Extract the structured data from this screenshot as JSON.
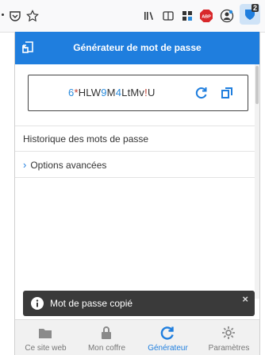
{
  "browser": {
    "badge_count": "2",
    "abp_label": "ABP"
  },
  "popup": {
    "title": "Générateur de mot de passe",
    "password": {
      "segments": [
        {
          "text": "6",
          "kind": "digit"
        },
        {
          "text": "*",
          "kind": "sym"
        },
        {
          "text": "HLW",
          "kind": "letter"
        },
        {
          "text": "9",
          "kind": "digit"
        },
        {
          "text": "M",
          "kind": "letter"
        },
        {
          "text": "4",
          "kind": "digit"
        },
        {
          "text": "LtMv",
          "kind": "letter"
        },
        {
          "text": "!",
          "kind": "sym"
        },
        {
          "text": "U",
          "kind": "letter"
        }
      ]
    },
    "history_label": "Historique des mots de passe",
    "advanced_label": "Options avancées",
    "toast_message": "Mot de passe copié",
    "toast_close": "×",
    "nav": [
      {
        "label": "Ce site web",
        "icon": "folder-icon",
        "active": false
      },
      {
        "label": "Mon coffre",
        "icon": "lock-icon",
        "active": false
      },
      {
        "label": "Générateur",
        "icon": "refresh-icon",
        "active": true
      },
      {
        "label": "Paramètres",
        "icon": "gear-icon",
        "active": false
      }
    ]
  },
  "colors": {
    "accent": "#1f7ede",
    "digit": "#2b8bdc",
    "symbol": "#c0392b",
    "toast_bg": "#3a3a3a"
  }
}
